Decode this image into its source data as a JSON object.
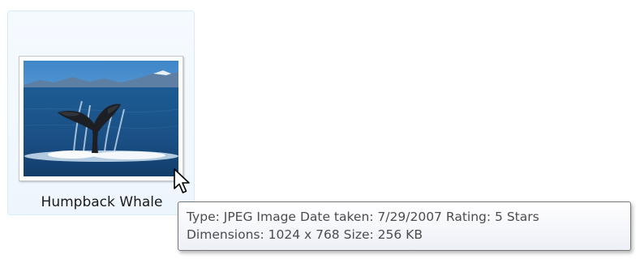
{
  "file": {
    "name": "Humpback Whale",
    "thumbnail_icon": "whale-tail-photo"
  },
  "tooltip": {
    "type": "Type: JPEG Image",
    "date_taken": "Date taken: 7/29/2007",
    "rating": "Rating: 5 Stars",
    "dimensions": "Dimensions: 1024 x 768",
    "size": "Size: 256 KB"
  },
  "colors": {
    "tile_border": "#d9e9f7",
    "tile_background": "#eef6fd",
    "tooltip_text": "#4c4c4c",
    "tooltip_border": "#767676"
  }
}
